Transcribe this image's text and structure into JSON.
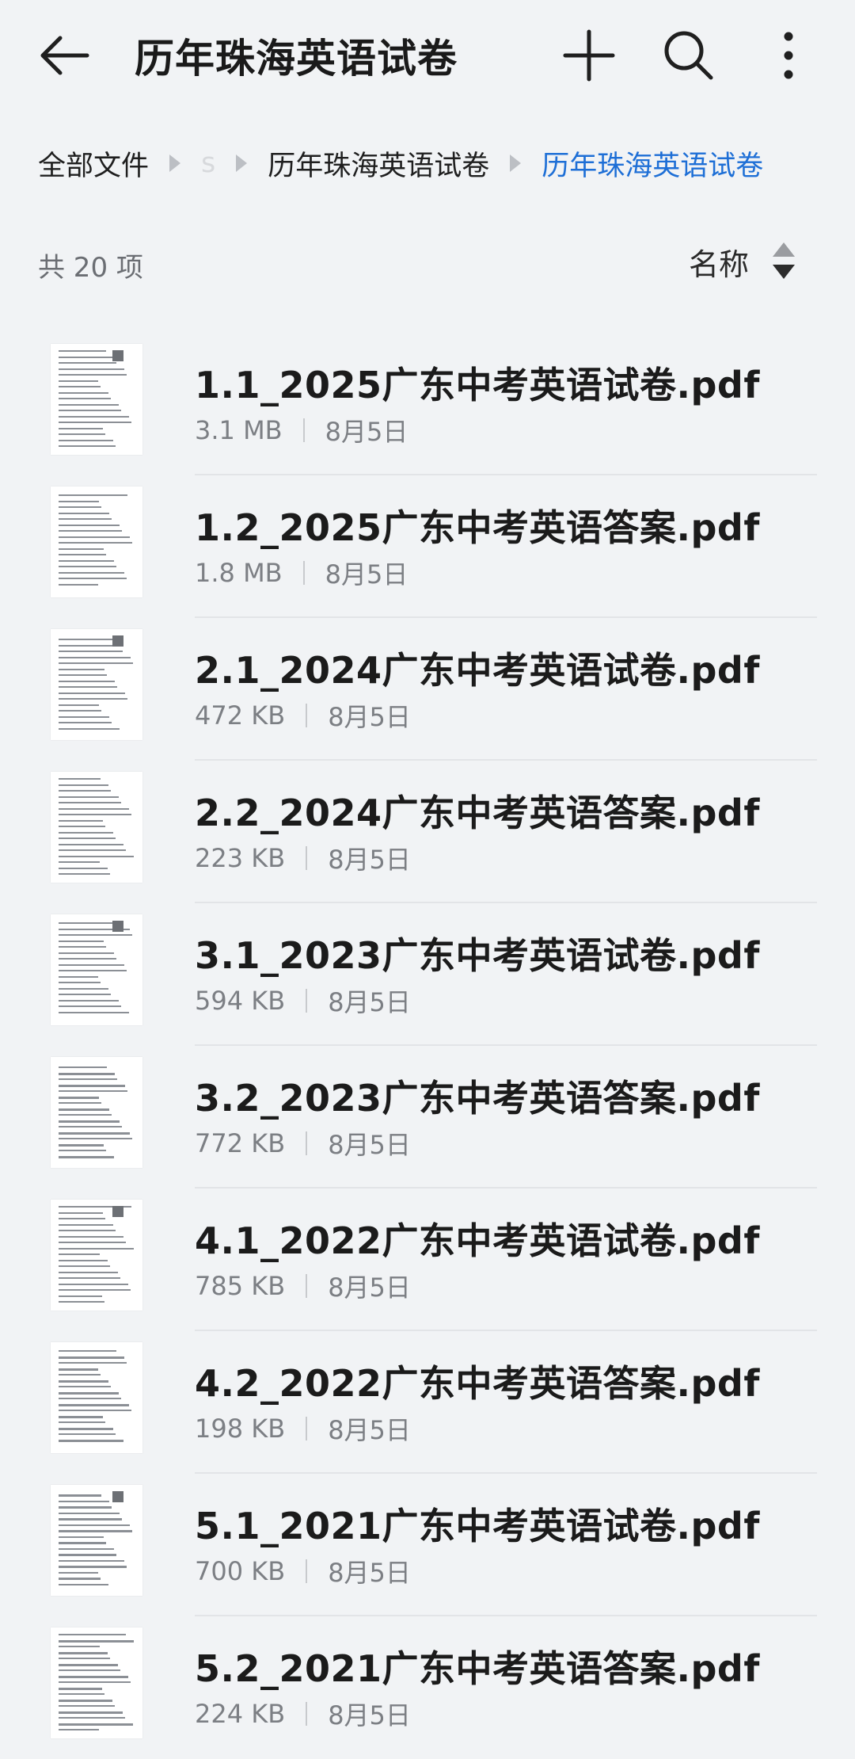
{
  "header": {
    "title": "历年珠海英语试卷",
    "back_icon": "arrow-left-icon",
    "add_icon": "plus-icon",
    "search_icon": "search-icon",
    "more_icon": "more-vertical-icon"
  },
  "breadcrumb": {
    "items": [
      {
        "label": "全部文件",
        "state": "normal"
      },
      {
        "label": "s",
        "state": "faded"
      },
      {
        "label": "历年珠海英语试卷",
        "state": "normal"
      },
      {
        "label": "历年珠海英语试卷",
        "state": "active"
      }
    ]
  },
  "summary": {
    "count_text": "共 20 项",
    "sort_label": "名称"
  },
  "colors": {
    "accent": "#1e6fd6",
    "background": "#f1f3f5",
    "text_primary": "#1b1b1b",
    "text_secondary": "#7c7f84"
  },
  "files": [
    {
      "name": "1.1_2025广东中考英语试卷.pdf",
      "size": "3.1 MB",
      "date": "8月5日",
      "icon": "pdf-thumbnail"
    },
    {
      "name": "1.2_2025广东中考英语答案.pdf",
      "size": "1.8 MB",
      "date": "8月5日",
      "icon": "pdf-thumbnail"
    },
    {
      "name": "2.1_2024广东中考英语试卷.pdf",
      "size": "472 KB",
      "date": "8月5日",
      "icon": "pdf-thumbnail"
    },
    {
      "name": "2.2_2024广东中考英语答案.pdf",
      "size": "223 KB",
      "date": "8月5日",
      "icon": "pdf-thumbnail"
    },
    {
      "name": "3.1_2023广东中考英语试卷.pdf",
      "size": "594 KB",
      "date": "8月5日",
      "icon": "pdf-thumbnail"
    },
    {
      "name": "3.2_2023广东中考英语答案.pdf",
      "size": "772 KB",
      "date": "8月5日",
      "icon": "pdf-thumbnail"
    },
    {
      "name": "4.1_2022广东中考英语试卷.pdf",
      "size": "785 KB",
      "date": "8月5日",
      "icon": "pdf-thumbnail"
    },
    {
      "name": "4.2_2022广东中考英语答案.pdf",
      "size": "198 KB",
      "date": "8月5日",
      "icon": "pdf-thumbnail"
    },
    {
      "name": "5.1_2021广东中考英语试卷.pdf",
      "size": "700 KB",
      "date": "8月5日",
      "icon": "pdf-thumbnail"
    },
    {
      "name": "5.2_2021广东中考英语答案.pdf",
      "size": "224 KB",
      "date": "8月5日",
      "icon": "pdf-thumbnail"
    }
  ]
}
